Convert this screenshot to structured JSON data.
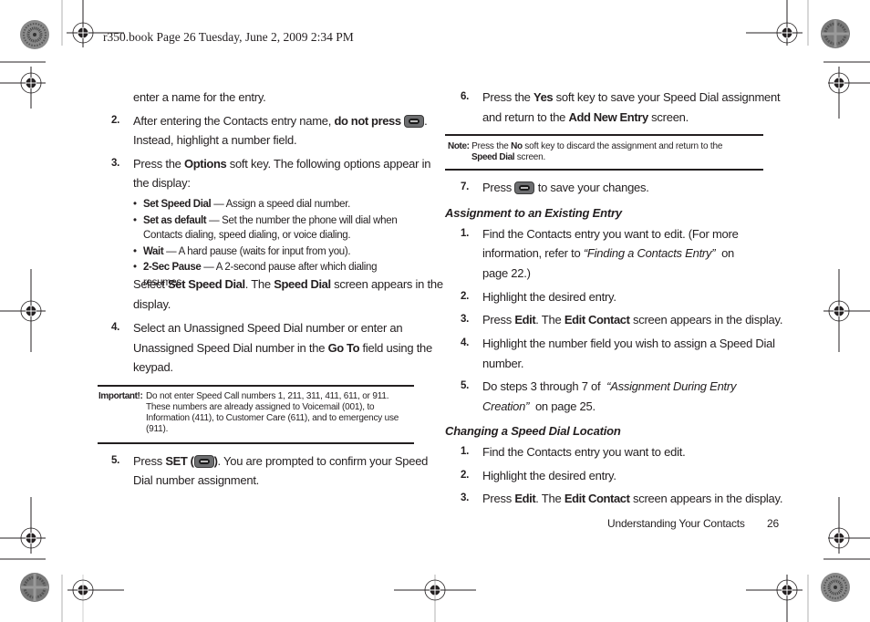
{
  "header": {
    "print_slug": "r350.book  Page 26  Tuesday, June 2, 2009  2:34 PM"
  },
  "left_column": {
    "continuation": "enter a name for the entry.",
    "step2": {
      "number": "2.",
      "text_before": "After entering the Contacts entry name, ",
      "bold": "do not press",
      "text_after_line1": ".",
      "line2": "Instead, highlight a number field.",
      "key_icon": "end-key-icon"
    },
    "step3": {
      "number": "3.",
      "prefix": "Press the ",
      "bold": "Options",
      "line1_rest": " soft key. The following options appear in",
      "line2": "the display:"
    },
    "options": [
      {
        "label": "Set Speed Dial",
        "desc": " — Assign a speed dial number."
      },
      {
        "label": "Set as default",
        "desc": " — Set the number the phone will dial when",
        "desc_line2": "Contacts dialing, speed dialing, or voice dialing."
      },
      {
        "label": "Wait",
        "desc": " — A hard pause (waits for input from you)."
      },
      {
        "label": "2-Sec Pause",
        "desc": " — A 2-second pause after which dialing resumes."
      }
    ],
    "select_line": {
      "prefix": "Select ",
      "bold1": "Set Speed Dial",
      "mid": ". The ",
      "bold2": "Speed Dial",
      "suffix": " screen appears in the",
      "line2": "display."
    },
    "step4": {
      "number": "4.",
      "line1": "Select an Unassigned Speed Dial number or enter an",
      "line2_prefix": "Unassigned Speed Dial number in the ",
      "line2_bold": "Go To",
      "line2_suffix": " field using the",
      "line3": "keypad."
    },
    "important": {
      "label": "Important!:",
      "line1": "Do not enter Speed Call numbers 1, 211, 311, 411, 611, or 911.",
      "line2": "These numbers are already assigned to Voicemail (001), to",
      "line3": "Information (411), to Customer Care (611), and to emergency use",
      "line4": "(911)."
    },
    "step5": {
      "number": "5.",
      "prefix": "Press ",
      "bold": "SET (",
      "bold_close": ")",
      "line1_rest": ". You are prompted to confirm your Speed",
      "line2": "Dial number assignment.",
      "key_icon": "end-key-icon"
    }
  },
  "right_column": {
    "step6": {
      "number": "6.",
      "prefix": "Press the ",
      "bold": "Yes",
      "line1_rest": " soft key to save your Speed Dial assignment",
      "line2_prefix": "and return to the ",
      "line2_bold": "Add New Entry",
      "line2_suffix": " screen."
    },
    "note": {
      "label": "Note:",
      "prefix": " Press the ",
      "bold1": "No",
      "line1_rest": " soft key to discard the assignment and return to the",
      "bold2": "Speed Dial",
      "line2_rest": " screen."
    },
    "step7": {
      "number": "7.",
      "prefix": "Press ",
      "suffix": " to save your changes.",
      "key_icon": "end-key-icon"
    },
    "section1": {
      "title": "Assignment to an Existing Entry",
      "steps": [
        {
          "number": "1.",
          "line1": "Find the Contacts entry you want to edit. (For more",
          "line2_prefix": "information, refer to ",
          "line2_italic": "“Finding a Contacts Entry”",
          "line2_suffix": "  on",
          "line3": "page 22.)"
        },
        {
          "number": "2.",
          "line1": "Highlight the desired entry."
        },
        {
          "number": "3.",
          "prefix": "Press ",
          "bold1": "Edit",
          "mid": ". The ",
          "bold2": "Edit Contact",
          "suffix": " screen appears in the display."
        },
        {
          "number": "4.",
          "line1": "Highlight the number field you wish to assign a Speed Dial",
          "line2": "number."
        },
        {
          "number": "5.",
          "prefix": "Do steps 3 through 7 of  ",
          "italic1": "“Assignment During Entry",
          "italic2": "Creation”",
          "suffix": "  on page 25."
        }
      ]
    },
    "section2": {
      "title": "Changing a Speed Dial Location",
      "steps": [
        {
          "number": "1.",
          "line1": "Find the Contacts entry you want to edit."
        },
        {
          "number": "2.",
          "line1": "Highlight the desired entry."
        },
        {
          "number": "3.",
          "prefix": "Press ",
          "bold1": "Edit",
          "mid": ". The ",
          "bold2": "Edit Contact",
          "suffix": " screen appears in the display."
        }
      ]
    }
  },
  "footer": {
    "section_name": "Understanding Your Contacts",
    "page_number": "26"
  },
  "colors": {
    "text": "#231f20",
    "key_gray": "#6d6e70"
  }
}
